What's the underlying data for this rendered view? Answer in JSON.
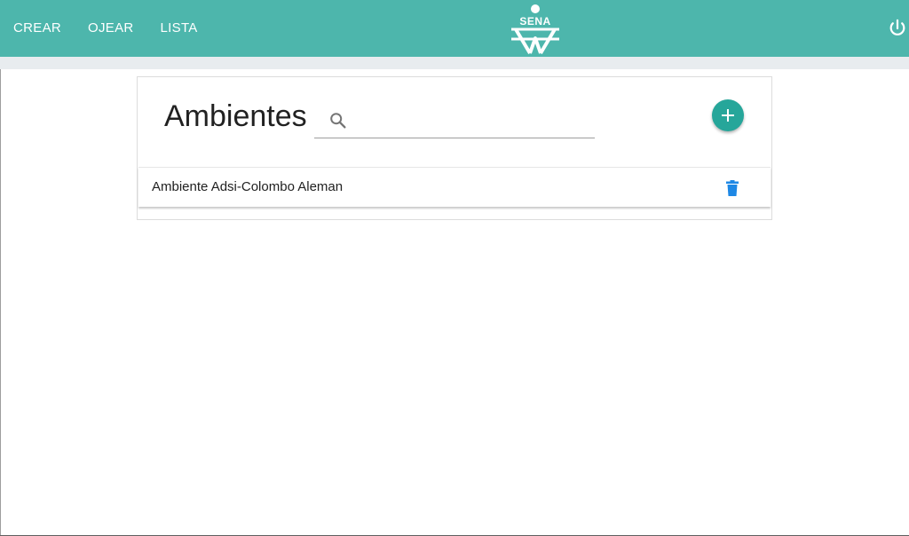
{
  "nav": {
    "items": [
      {
        "label": "CREAR"
      },
      {
        "label": "OJEAR"
      },
      {
        "label": "LISTA"
      }
    ]
  },
  "logo": {
    "text": "SENA",
    "icon": "sena-logo-icon"
  },
  "header": {
    "power_icon": "power-icon"
  },
  "card": {
    "title": "Ambientes",
    "search": {
      "placeholder": "",
      "value": "",
      "icon": "search-icon"
    },
    "add_icon": "plus-icon",
    "items": [
      {
        "label": "Ambiente Adsi-Colombo Aleman",
        "delete_icon": "trash-icon"
      }
    ]
  },
  "colors": {
    "header_bg": "#4db6ac",
    "fab": "#26a69a",
    "delete_icon": "#1e88e5",
    "strip_bg": "#e8ecef"
  }
}
